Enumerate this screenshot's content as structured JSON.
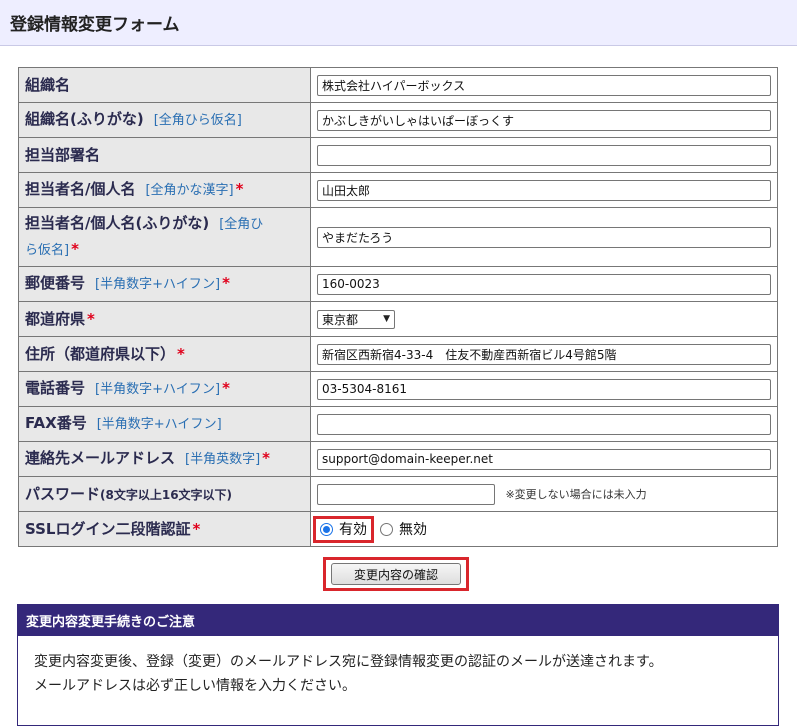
{
  "header": {
    "title": "登録情報変更フォーム"
  },
  "form": {
    "org_name": {
      "label": "組織名",
      "value": "株式会社ハイパーボックス"
    },
    "org_kana": {
      "label": "組織名(ふりがな)",
      "hint": "[全角ひら仮名]",
      "value": "かぶしきがいしゃはいぱーぼっくす"
    },
    "dept": {
      "label": "担当部署名",
      "value": ""
    },
    "person": {
      "label": "担当者名/個人名",
      "hint": "[全角かな漢字]",
      "required": "*",
      "value": "山田太郎"
    },
    "person_kana": {
      "label": "担当者名/個人名(ふりがな)",
      "hint_a": "[全角ひ",
      "hint_b": "ら仮名]",
      "required": "*",
      "value": "やまだたろう"
    },
    "zip": {
      "label": "郵便番号",
      "hint": "[半角数字+ハイフン]",
      "required": "*",
      "value": "160-0023"
    },
    "pref": {
      "label": "都道府県",
      "required": "*",
      "selected": "東京都"
    },
    "address": {
      "label": "住所（都道府県以下）",
      "required": "*",
      "value": "新宿区西新宿4-33-4　住友不動産西新宿ビル4号館5階"
    },
    "tel": {
      "label": "電話番号",
      "hint": "[半角数字+ハイフン]",
      "required": "*",
      "value": "03-5304-8161"
    },
    "fax": {
      "label": "FAX番号",
      "hint": "[半角数字+ハイフン]",
      "value": ""
    },
    "email": {
      "label": "連絡先メールアドレス",
      "hint": "[半角英数字]",
      "required": "*",
      "value": "support@domain-keeper.net"
    },
    "password": {
      "label": "パスワード",
      "label_note": "(8文字以上16文字以下)",
      "value": "",
      "note": "※変更しない場合には未入力"
    },
    "ssl": {
      "label": "SSLログイン二段階認証",
      "required": "*",
      "option_on": "有効",
      "option_off": "無効",
      "selected": "有効"
    }
  },
  "confirm_button": {
    "label": "変更内容の確認"
  },
  "notice": {
    "title": "変更内容変更手続きのご注意",
    "line1": "変更内容変更後、登録（変更）のメールアドレス宛に登録情報変更の認証のメールが送達されます。",
    "line2": "メールアドレスは必ず正しい情報を入力ください。"
  },
  "colors": {
    "accent": "#34287a",
    "highlight": "#d9262c",
    "required": "#e0001b",
    "hint": "#2a6fb3"
  }
}
